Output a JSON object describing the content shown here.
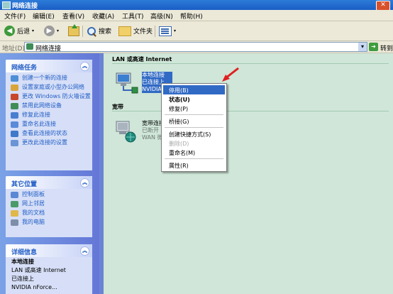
{
  "window": {
    "title": "网络连接",
    "close": "✕"
  },
  "menu": {
    "items": [
      "文件(F)",
      "编辑(E)",
      "查看(V)",
      "收藏(A)",
      "工具(T)",
      "高级(N)",
      "帮助(H)"
    ]
  },
  "toolbar": {
    "back": "后退",
    "search": "搜索",
    "folders": "文件夹"
  },
  "address": {
    "label": "地址(D)",
    "value": "网络连接",
    "go": "转到"
  },
  "left": {
    "tasks": {
      "title": "网络任务",
      "items": [
        "创建一个新的连接",
        "设置家庭或小型办公网络",
        "更改 Windows 防火墙设置",
        "禁用此网络设备",
        "修复此连接",
        "重命名此连接",
        "查看此连接的状态",
        "更改此连接的设置"
      ]
    },
    "other": {
      "title": "其它位置",
      "items": [
        "控制面板",
        "网上邻居",
        "我的文档",
        "我的电脑"
      ]
    },
    "details": {
      "title": "详细信息",
      "lines": [
        "本地连接",
        "LAN 或高速 Internet",
        "已连接上",
        "NVIDIA nForce..."
      ]
    }
  },
  "right": {
    "group_lan": "LAN 或高速 Internet",
    "lan_conn": {
      "name": "本地连接",
      "status": "已连接上",
      "device": "NVIDIA n..."
    },
    "group_broadband": "宽带",
    "bb_conn": {
      "name": "宽带连接",
      "status": "已断开",
      "device": "WAN 微型..."
    }
  },
  "context_menu": {
    "items": [
      "停用(B)",
      "状态(U)",
      "修复(P)",
      "桥接(G)",
      "创建快捷方式(S)",
      "删除(D)",
      "重命名(M)",
      "属性(R)"
    ]
  },
  "colors": {
    "selection": "#316ac5",
    "task_link": "#215dc6",
    "panel_bg": "#d6dff7",
    "content_bg": "#cfe6d8",
    "arrow": "#e02020"
  }
}
